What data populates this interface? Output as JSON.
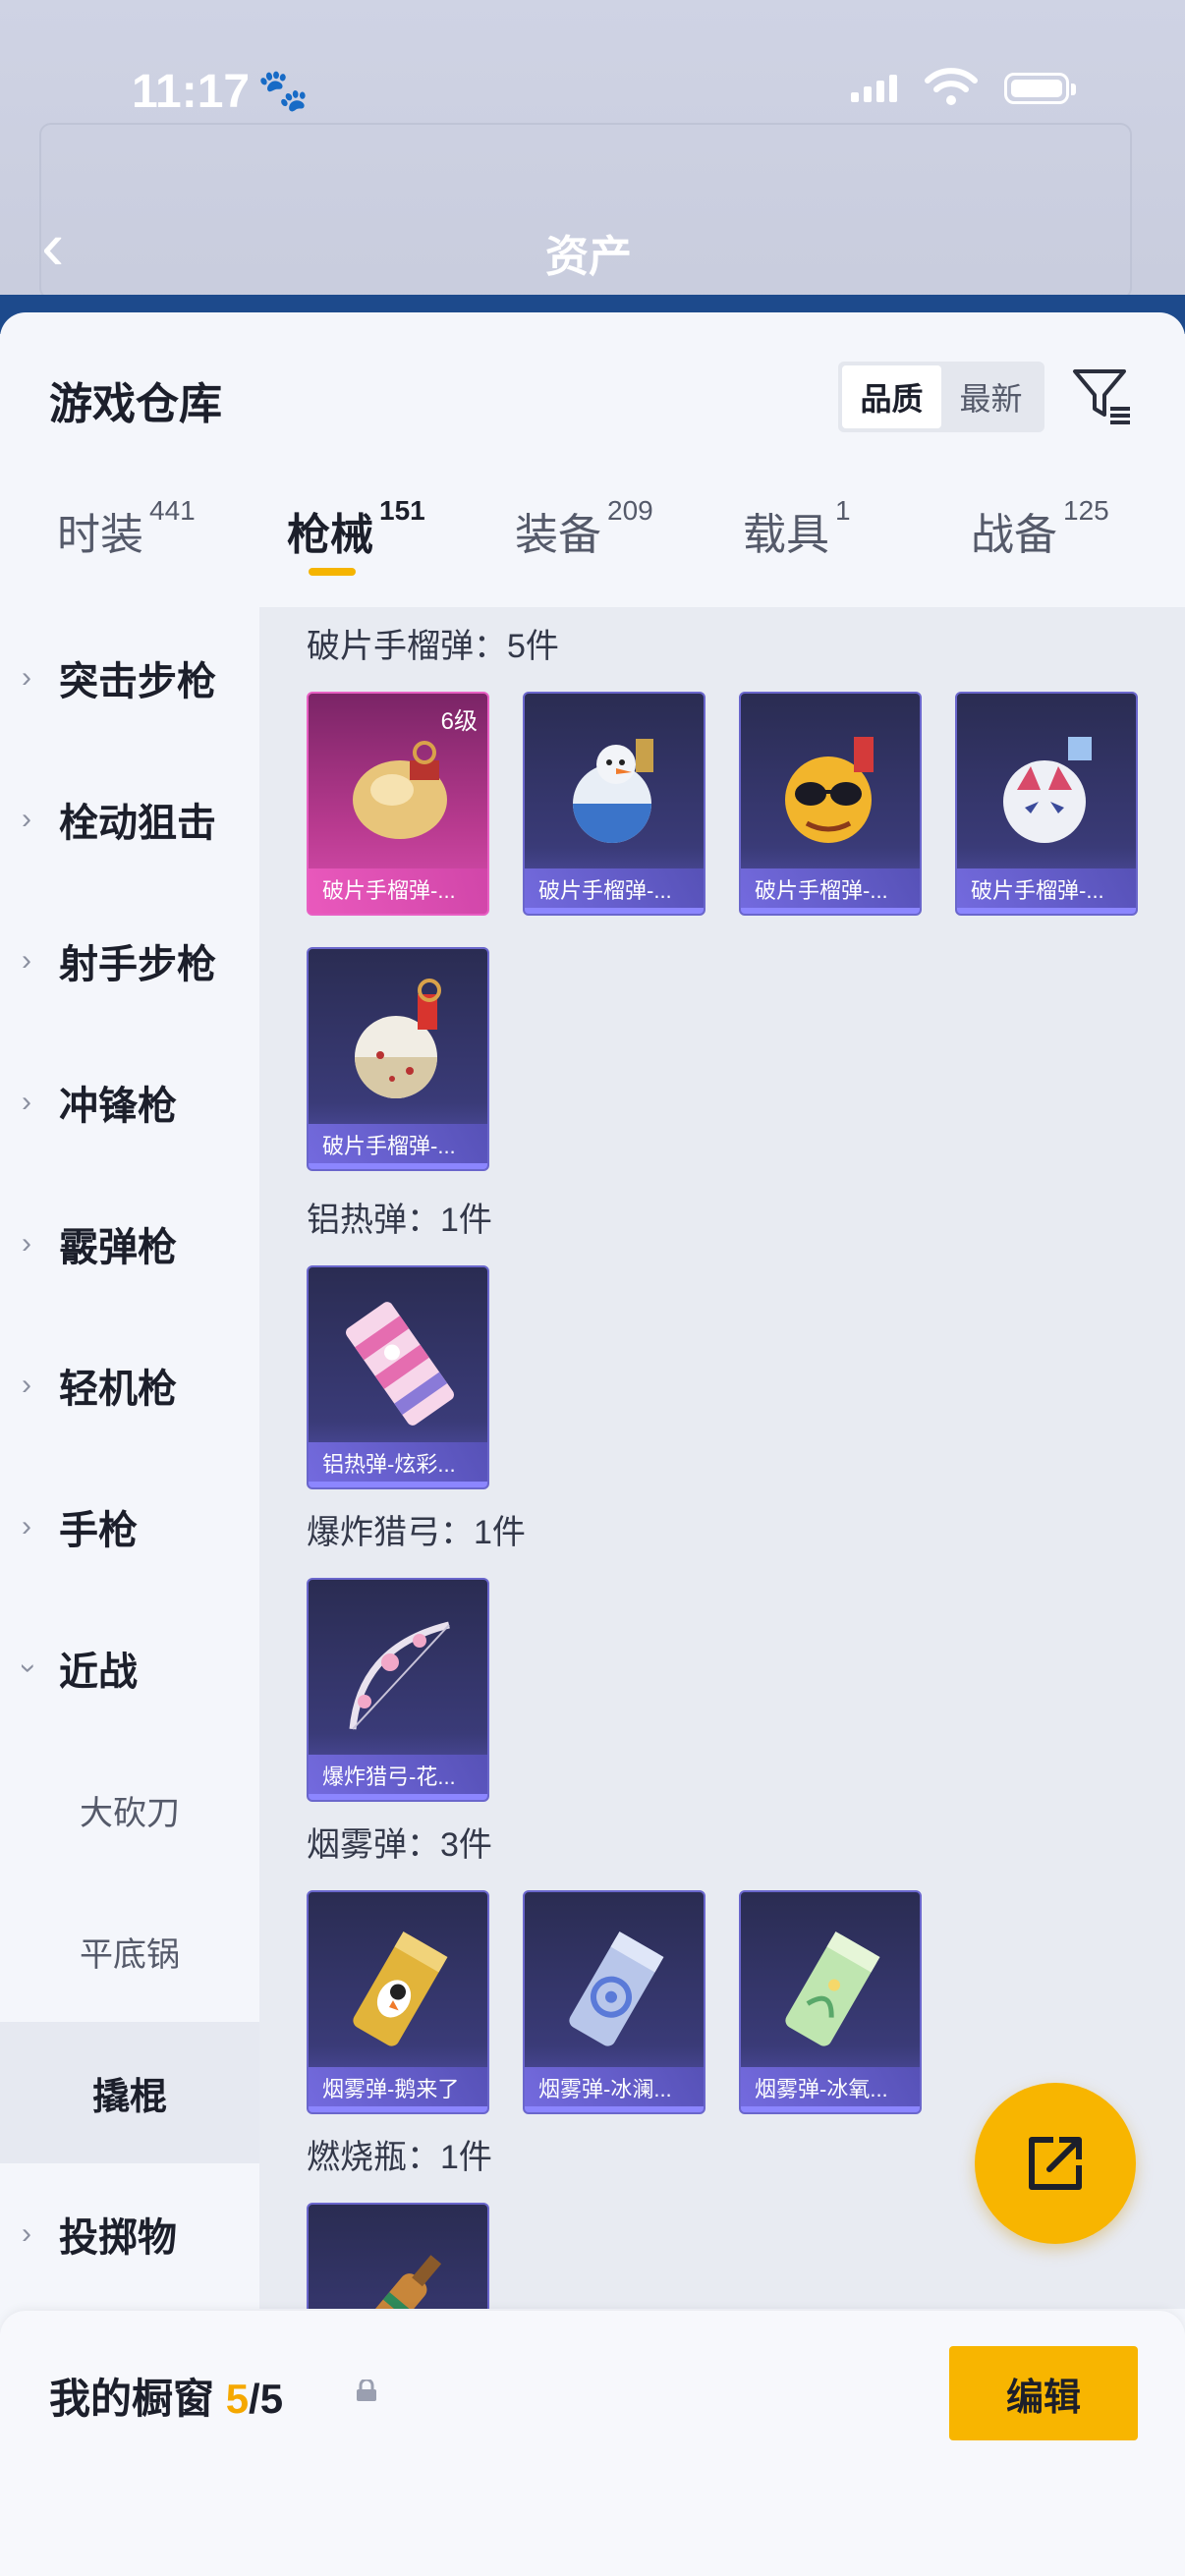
{
  "status_bar": {
    "time": "11:17"
  },
  "background": {
    "title": "资产"
  },
  "sheet": {
    "title": "游戏仓库",
    "sort_options": [
      "品质",
      "最新"
    ],
    "active_sort": "品质"
  },
  "category_tabs": [
    {
      "label": "时装",
      "count": "441"
    },
    {
      "label": "枪械",
      "count": "151",
      "active": true
    },
    {
      "label": "装备",
      "count": "209"
    },
    {
      "label": "载具",
      "count": "1"
    },
    {
      "label": "战备",
      "count": "125"
    }
  ],
  "side_nav": [
    {
      "label": "突击步枪",
      "type": "collapsed"
    },
    {
      "label": "栓动狙击",
      "type": "collapsed"
    },
    {
      "label": "射手步枪",
      "type": "collapsed"
    },
    {
      "label": "冲锋枪",
      "type": "collapsed"
    },
    {
      "label": "霰弹枪",
      "type": "collapsed"
    },
    {
      "label": "轻机枪",
      "type": "collapsed"
    },
    {
      "label": "手枪",
      "type": "collapsed"
    },
    {
      "label": "近战",
      "type": "expanded"
    },
    {
      "label": "大砍刀",
      "type": "sub"
    },
    {
      "label": "平底锅",
      "type": "sub"
    },
    {
      "label": "撬棍",
      "type": "selected"
    },
    {
      "label": "投掷物",
      "type": "collapsed"
    }
  ],
  "groups": [
    {
      "title": "破片手榴弹：5件",
      "items": [
        {
          "name": "破片手榴弹-...",
          "badge": "6级",
          "rarity": "legend",
          "icon": "golden-grenade"
        },
        {
          "name": "破片手榴弹-...",
          "rarity": "epic",
          "icon": "snowman-grenade"
        },
        {
          "name": "破片手榴弹-...",
          "rarity": "epic",
          "icon": "sunglasses-grenade"
        },
        {
          "name": "破片手榴弹-...",
          "rarity": "epic",
          "icon": "fox-mask-grenade"
        },
        {
          "name": "破片手榴弹-...",
          "rarity": "epic",
          "icon": "star-grenade"
        }
      ]
    },
    {
      "title": "铝热弹：1件",
      "items": [
        {
          "name": "铝热弹-炫彩...",
          "rarity": "epic",
          "icon": "candy-thermite"
        }
      ]
    },
    {
      "title": "爆炸猎弓：1件",
      "items": [
        {
          "name": "爆炸猎弓-花...",
          "rarity": "epic",
          "icon": "flower-bow"
        }
      ]
    },
    {
      "title": "烟雾弹：3件",
      "items": [
        {
          "name": "烟雾弹-鹅来了",
          "rarity": "epic",
          "icon": "goose-smoke"
        },
        {
          "name": "烟雾弹-冰澜...",
          "rarity": "epic",
          "icon": "ice-smoke"
        },
        {
          "name": "烟雾弹-冰氧...",
          "rarity": "epic",
          "icon": "green-smoke"
        }
      ]
    },
    {
      "title": "燃烧瓶：1件",
      "items": [
        {
          "name": "",
          "rarity": "epic",
          "icon": "molotov"
        }
      ]
    }
  ],
  "showcase": {
    "title": "我的橱窗",
    "current": "5",
    "separator": "/",
    "max": "5",
    "edit_label": "编辑"
  },
  "colors": {
    "accent": "#f8b500",
    "epic": "#5a56b8",
    "legend": "#d94fb0"
  }
}
